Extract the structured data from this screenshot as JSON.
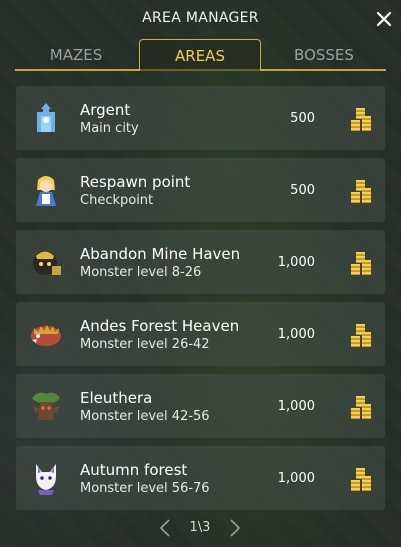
{
  "dialog": {
    "title": "AREA MANAGER",
    "close_icon": "close-icon"
  },
  "tabs": [
    {
      "label": "MAZES",
      "active": false
    },
    {
      "label": "AREAS",
      "active": true
    },
    {
      "label": "BOSSES",
      "active": false
    }
  ],
  "areas": [
    {
      "name": "Argent",
      "subtitle": "Main city",
      "cost": "500",
      "icon": "city-icon"
    },
    {
      "name": "Respawn point",
      "subtitle": "Checkpoint",
      "cost": "500",
      "icon": "respawn-npc-icon"
    },
    {
      "name": "Abandon Mine Haven",
      "subtitle": "Monster level 8-26",
      "cost": "1,000",
      "icon": "miner-monster-icon"
    },
    {
      "name": "Andes Forest Heaven",
      "subtitle": "Monster level 26-42",
      "cost": "1,000",
      "icon": "boar-monster-icon"
    },
    {
      "name": "Eleuthera",
      "subtitle": "Monster level 42-56",
      "cost": "1,000",
      "icon": "treant-monster-icon"
    },
    {
      "name": "Autumn forest",
      "subtitle": "Monster level 56-76",
      "cost": "1,000",
      "icon": "fox-monster-icon"
    }
  ],
  "pagination": {
    "label": "1\\3",
    "prev_icon": "chevron-left-icon",
    "next_icon": "chevron-right-icon"
  },
  "colors": {
    "accent": "#d2ae3e",
    "active_tab_text": "#f3cd56",
    "inactive_tab_text": "#9aa0a0"
  }
}
